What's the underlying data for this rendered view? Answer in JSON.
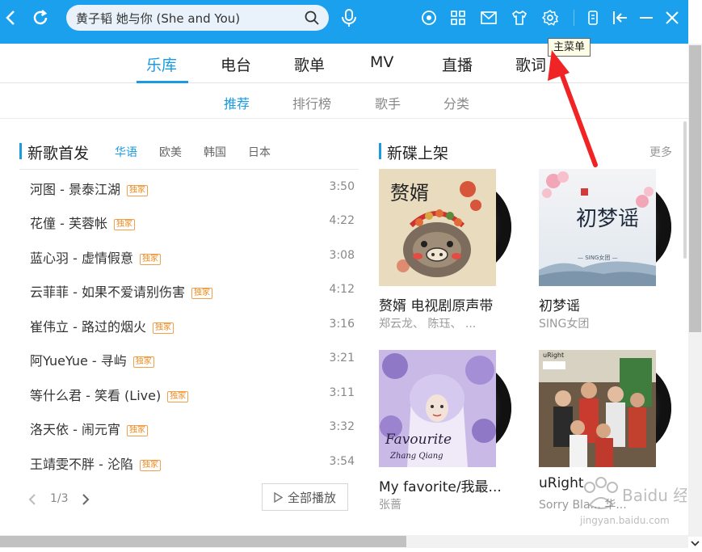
{
  "titlebar": {
    "search_value": "黄子韬 她与你 (She and You)",
    "icons": [
      "back-icon",
      "refresh-icon",
      "search-icon",
      "voice-search-icon",
      "radio-icon",
      "apps-icon",
      "mail-icon",
      "skin-icon",
      "settings-icon",
      "mini-mode-icon",
      "collapse-icon",
      "minimize-icon",
      "close-icon"
    ],
    "accent_color": "#1aa0ec"
  },
  "tooltip": "主菜单",
  "main_tabs": [
    {
      "label": "乐库",
      "active": true
    },
    {
      "label": "电台"
    },
    {
      "label": "歌单"
    },
    {
      "label": "MV"
    },
    {
      "label": "直播"
    },
    {
      "label": "歌词"
    }
  ],
  "sub_tabs": [
    {
      "label": "推荐",
      "active": true
    },
    {
      "label": "排行榜"
    },
    {
      "label": "歌手"
    },
    {
      "label": "分类"
    }
  ],
  "new_songs": {
    "title": "新歌首发",
    "languages": [
      {
        "label": "华语",
        "active": true
      },
      {
        "label": "欧美"
      },
      {
        "label": "韩国"
      },
      {
        "label": "日本"
      }
    ],
    "badge": "独家",
    "songs": [
      {
        "title": "河图 - 景泰江湖",
        "duration": "3:50"
      },
      {
        "title": "花僮 - 芙蓉帐",
        "duration": "4:22"
      },
      {
        "title": "蓝心羽 - 虚情假意",
        "duration": "3:08"
      },
      {
        "title": "云菲菲 - 如果不爱请别伤害",
        "duration": "4:12"
      },
      {
        "title": "崔伟立 - 路过的烟火",
        "duration": "3:16"
      },
      {
        "title": "阿YueYue - 寻屿",
        "duration": "3:21"
      },
      {
        "title": "等什么君 - 笑看 (Live)",
        "duration": "3:11"
      },
      {
        "title": "洛天依 - 闹元宵",
        "duration": "3:32"
      },
      {
        "title": "王靖雯不胖 - 沦陷",
        "duration": "3:54"
      }
    ],
    "pager": "1/3",
    "play_all": "全部播放"
  },
  "new_albums": {
    "title": "新碟上架",
    "more": "更多",
    "albums": [
      {
        "title": "赘婿 电视剧原声带",
        "artist": "郑云龙、 陈珏、 ...",
        "cover_text": "赘婿"
      },
      {
        "title": "初梦谣",
        "artist": "SING女团",
        "cover_text": "初梦谣",
        "cover_caption": "— SING女团 —"
      },
      {
        "title": "My favorite/我最...",
        "artist": "张蔷",
        "cover_text": "Favourite",
        "cover_sub": "Zhang Qiang"
      },
      {
        "title": "uRight",
        "artist": "Sorry Bla... 华...",
        "cover_text": "uRight"
      }
    ]
  },
  "watermark": {
    "brand": "Baidu 经验",
    "url": "jingyan.baidu.com"
  }
}
